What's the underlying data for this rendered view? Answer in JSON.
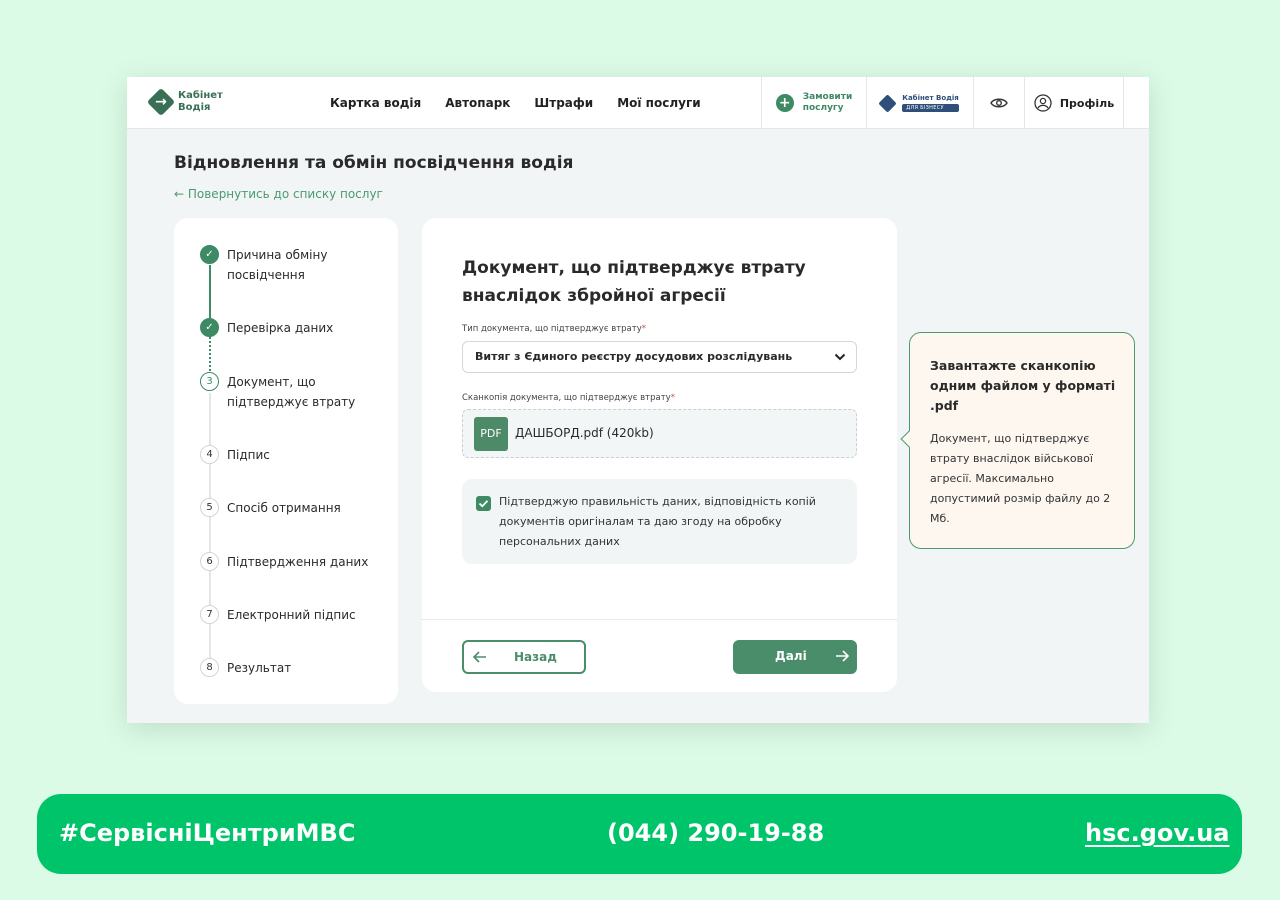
{
  "header": {
    "logo_line1": "Кабінет",
    "logo_line2": "Водія",
    "nav": [
      "Картка водія",
      "Автопарк",
      "Штрафи",
      "Мої послуги"
    ],
    "order_line1": "Замовити",
    "order_line2": "послугу",
    "biz_line1": "Кабінет Водія",
    "biz_badge": "ДЛЯ БІЗНЕСУ",
    "profile": "Профіль"
  },
  "page": {
    "title": "Відновлення та обмін посвідчення водія",
    "back_link": "← Повернутись до списку послуг"
  },
  "steps": [
    {
      "marker": "✓",
      "label": "Причина обміну посвідчення",
      "state": "done"
    },
    {
      "marker": "✓",
      "label": "Перевірка даних",
      "state": "done"
    },
    {
      "marker": "3",
      "label": "Документ, що підтверджує втрату",
      "state": "active"
    },
    {
      "marker": "4",
      "label": "Підпис",
      "state": "todo"
    },
    {
      "marker": "5",
      "label": "Спосіб отримання",
      "state": "todo"
    },
    {
      "marker": "6",
      "label": "Підтвердження даних",
      "state": "todo"
    },
    {
      "marker": "7",
      "label": "Електронний підпис",
      "state": "todo"
    },
    {
      "marker": "8",
      "label": "Результат",
      "state": "todo"
    }
  ],
  "form": {
    "title": "Документ, що підтверджує втрату внаслідок збройної агресії",
    "doc_type_label": "Тип документа, що підтверджує втрату",
    "doc_type_value": "Витяг з Єдиного реєстру досудових розслідувань",
    "scan_label": "Сканкопія документа, що підтверджує втрату",
    "required_mark": "*",
    "file_badge": "PDF",
    "file_name": "ДАШБОРД.pdf (420kb)",
    "consent_text": "Підтверджую правильність даних, відповідність копій документів оригіналам та даю згоду на обробку персональних даних",
    "back_button": "Назад",
    "next_button": "Далі"
  },
  "tooltip": {
    "title": "Завантажте сканкопію одним файлом у форматі .pdf",
    "text": "Документ, що підтверджує втрату внаслідок військової агресії. Максимально допустимий розмір файлу до 2 Мб."
  },
  "banner": {
    "hashtag": "#СервісніЦентриМВС",
    "phone": "(044) 290-19-88",
    "site": "hsc.gov.ua"
  },
  "colors": {
    "accent": "#3d8a64",
    "banner": "#00c46a",
    "background": "#dcfbe7"
  }
}
